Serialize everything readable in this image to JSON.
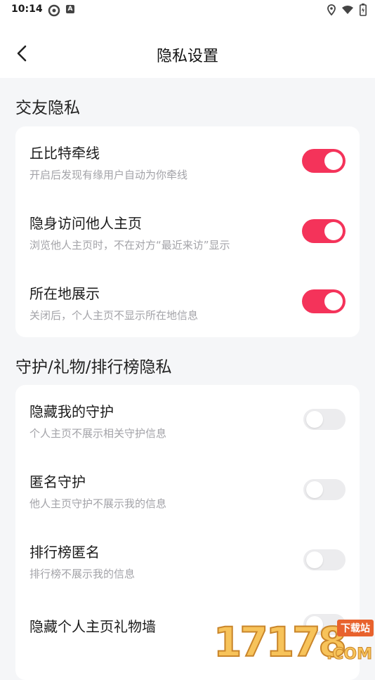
{
  "status_bar": {
    "time": "10:14",
    "notif_badge": "A"
  },
  "header": {
    "title": "隐私设置"
  },
  "sections": [
    {
      "title": "交友隐私",
      "items": [
        {
          "title": "丘比特牵线",
          "desc": "开启后发现有缘用户自动为你牵线",
          "enabled": true
        },
        {
          "title": "隐身访问他人主页",
          "desc": "浏览他人主页时，不在对方“最近来访”显示",
          "enabled": true
        },
        {
          "title": "所在地展示",
          "desc": "关闭后，个人主页不显示所在地信息",
          "enabled": true
        }
      ]
    },
    {
      "title": "守护/礼物/排行榜隐私",
      "items": [
        {
          "title": "隐藏我的守护",
          "desc": "个人主页不展示相关守护信息",
          "enabled": false
        },
        {
          "title": "匿名守护",
          "desc": "他人主页守护不展示我的信息",
          "enabled": false
        },
        {
          "title": "排行榜匿名",
          "desc": "排行榜不展示我的信息",
          "enabled": false
        },
        {
          "title": "隐藏个人主页礼物墙",
          "desc": "",
          "enabled": false
        }
      ]
    }
  ],
  "colors": {
    "toggle_on": "#f4335a",
    "toggle_off": "#ececee",
    "page_bg": "#f5f6f8"
  },
  "watermark": {
    "digits": "17178",
    "badge": "下载站",
    "suffix": ".COM"
  }
}
